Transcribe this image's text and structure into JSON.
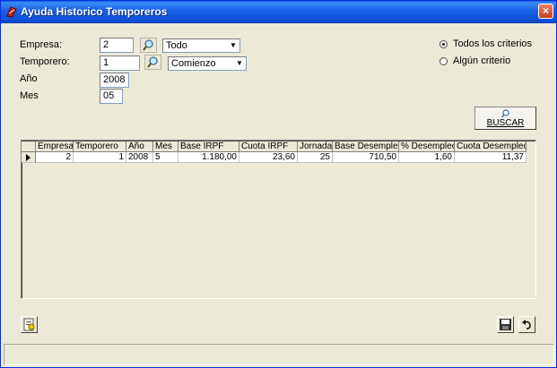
{
  "window": {
    "title": "Ayuda Historico Temporeros",
    "close_label": "×"
  },
  "form": {
    "empresa": {
      "label": "Empresa:",
      "value": "2",
      "filter": "Todo"
    },
    "temporero": {
      "label": "Temporero:",
      "value": "1",
      "filter": "Comienzo"
    },
    "anio": {
      "label": "Año",
      "value": "2008"
    },
    "mes": {
      "label": "Mes",
      "value": "05"
    }
  },
  "criteria": {
    "todos": "Todos los criterios",
    "alguno": "Algún criterio",
    "selected": "todos"
  },
  "buscar_label": "BUSCAR",
  "grid": {
    "columns": [
      "Empresa",
      "Temporero",
      "Año",
      "Mes",
      "Base IRPF",
      "Cuota IRPF",
      "Jornadas",
      "Base Desempleo",
      "% Desempleo",
      "Cuota Desempleo"
    ],
    "rows": [
      [
        "2",
        "1",
        "2008",
        "5",
        "1.180,00",
        "23,60",
        "25",
        "710,50",
        "1,60",
        "11,37"
      ]
    ]
  },
  "colors": {
    "titlebar": "#0c4fd6",
    "face": "#ece9d8",
    "close": "#c8401c"
  }
}
